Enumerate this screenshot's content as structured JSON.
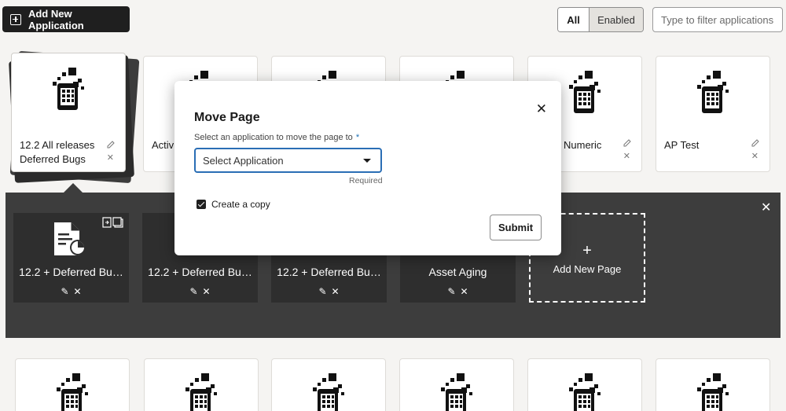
{
  "toolbar": {
    "add_application_label": "Add New Application",
    "filter_all_label": "All",
    "filter_enabled_label": "Enabled",
    "filter_placeholder": "Type to filter applications"
  },
  "applications_row1": [
    {
      "name_line1": "12.2 All releases",
      "name_line2": "Deferred Bugs",
      "selected": true
    },
    {
      "name_line1": "Activi",
      "name_line2": ""
    },
    {
      "name_line1": "",
      "name_line2": ""
    },
    {
      "name_line1": "",
      "name_line2": ""
    },
    {
      "name_line1": "Numeric",
      "name_line2": ""
    },
    {
      "name_line1": "AP Test",
      "name_line2": ""
    }
  ],
  "pages": [
    {
      "name": "12.2 + Deferred Bu…"
    },
    {
      "name": "12.2 + Deferred Bu…"
    },
    {
      "name": "12.2 + Deferred Bu…"
    },
    {
      "name": "Asset Aging"
    }
  ],
  "add_page_label": "Add New Page",
  "modal": {
    "title": "Move Page",
    "field_label": "Select an application to move the page to",
    "required_marker": "*",
    "select_placeholder": "Select Application",
    "required_hint": "Required",
    "copy_label": "Create a copy",
    "copy_checked": true,
    "submit_label": "Submit"
  },
  "icons": {
    "plus_square": "plus-square-icon",
    "app_logo": "app-logo-icon",
    "edit": "pencil-icon",
    "delete": "close-icon",
    "page_doc": "document-chart-icon"
  },
  "colors": {
    "button_dark": "#1f1f1f",
    "band_dark": "#3d3d3d",
    "focus_blue": "#2a6eb5"
  }
}
